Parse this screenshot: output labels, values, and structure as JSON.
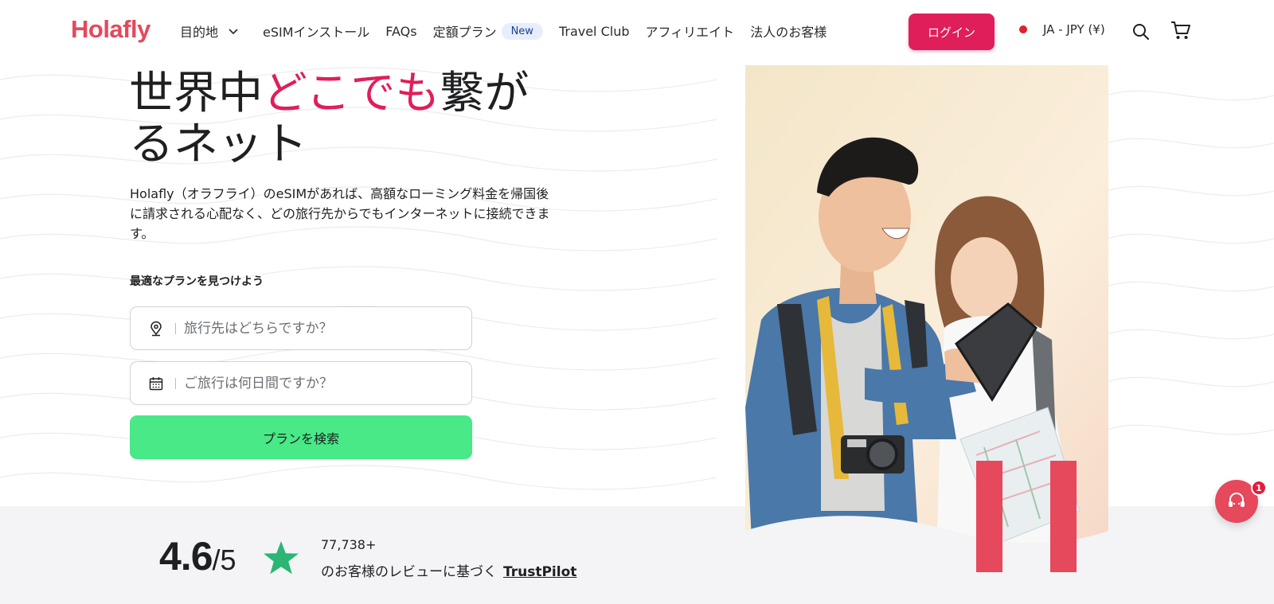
{
  "brand": {
    "logo_text": "Holafly",
    "accent_color": "#e01e5a",
    "logo_color": "#e6485c",
    "cta_color": "#48e986"
  },
  "nav": {
    "items": [
      {
        "label": "目的地",
        "has_dropdown": true
      },
      {
        "label": "eSIMインストール"
      },
      {
        "label": "FAQs"
      },
      {
        "label": "定額プラン",
        "badge": "New"
      },
      {
        "label": "Travel Club"
      },
      {
        "label": "アフィリエイト"
      },
      {
        "label": "法人のお客様"
      }
    ],
    "login_label": "ログイン",
    "language_label": "JA - JPY (¥)",
    "icons": [
      "search-icon",
      "cart-icon",
      "chevron-down-icon"
    ]
  },
  "hero": {
    "title_part1": "世界中",
    "title_accent": "どこでも",
    "title_part2": "繋が",
    "title_line2": "るネット",
    "description": "Holafly（オラフライ）のeSIMがあれば、高額なローミング料金を帰国後に請求される心配なく、どの旅行先からでもインターネットに接続できます。",
    "finder_label": "最適なプランを見つけよう",
    "destination_placeholder": "旅行先はどちらですか？",
    "days_placeholder": "ご旅行は何日間ですか？",
    "search_button": "プランを検索"
  },
  "rating": {
    "score": "4.6",
    "out_of": "/5",
    "reviews_count": "77,738+",
    "reviews_text": "のお客様のレビューに基づく",
    "provider_link": "TrustPilot"
  },
  "chat": {
    "badge_count": "1",
    "icon": "chat-support-icon"
  }
}
